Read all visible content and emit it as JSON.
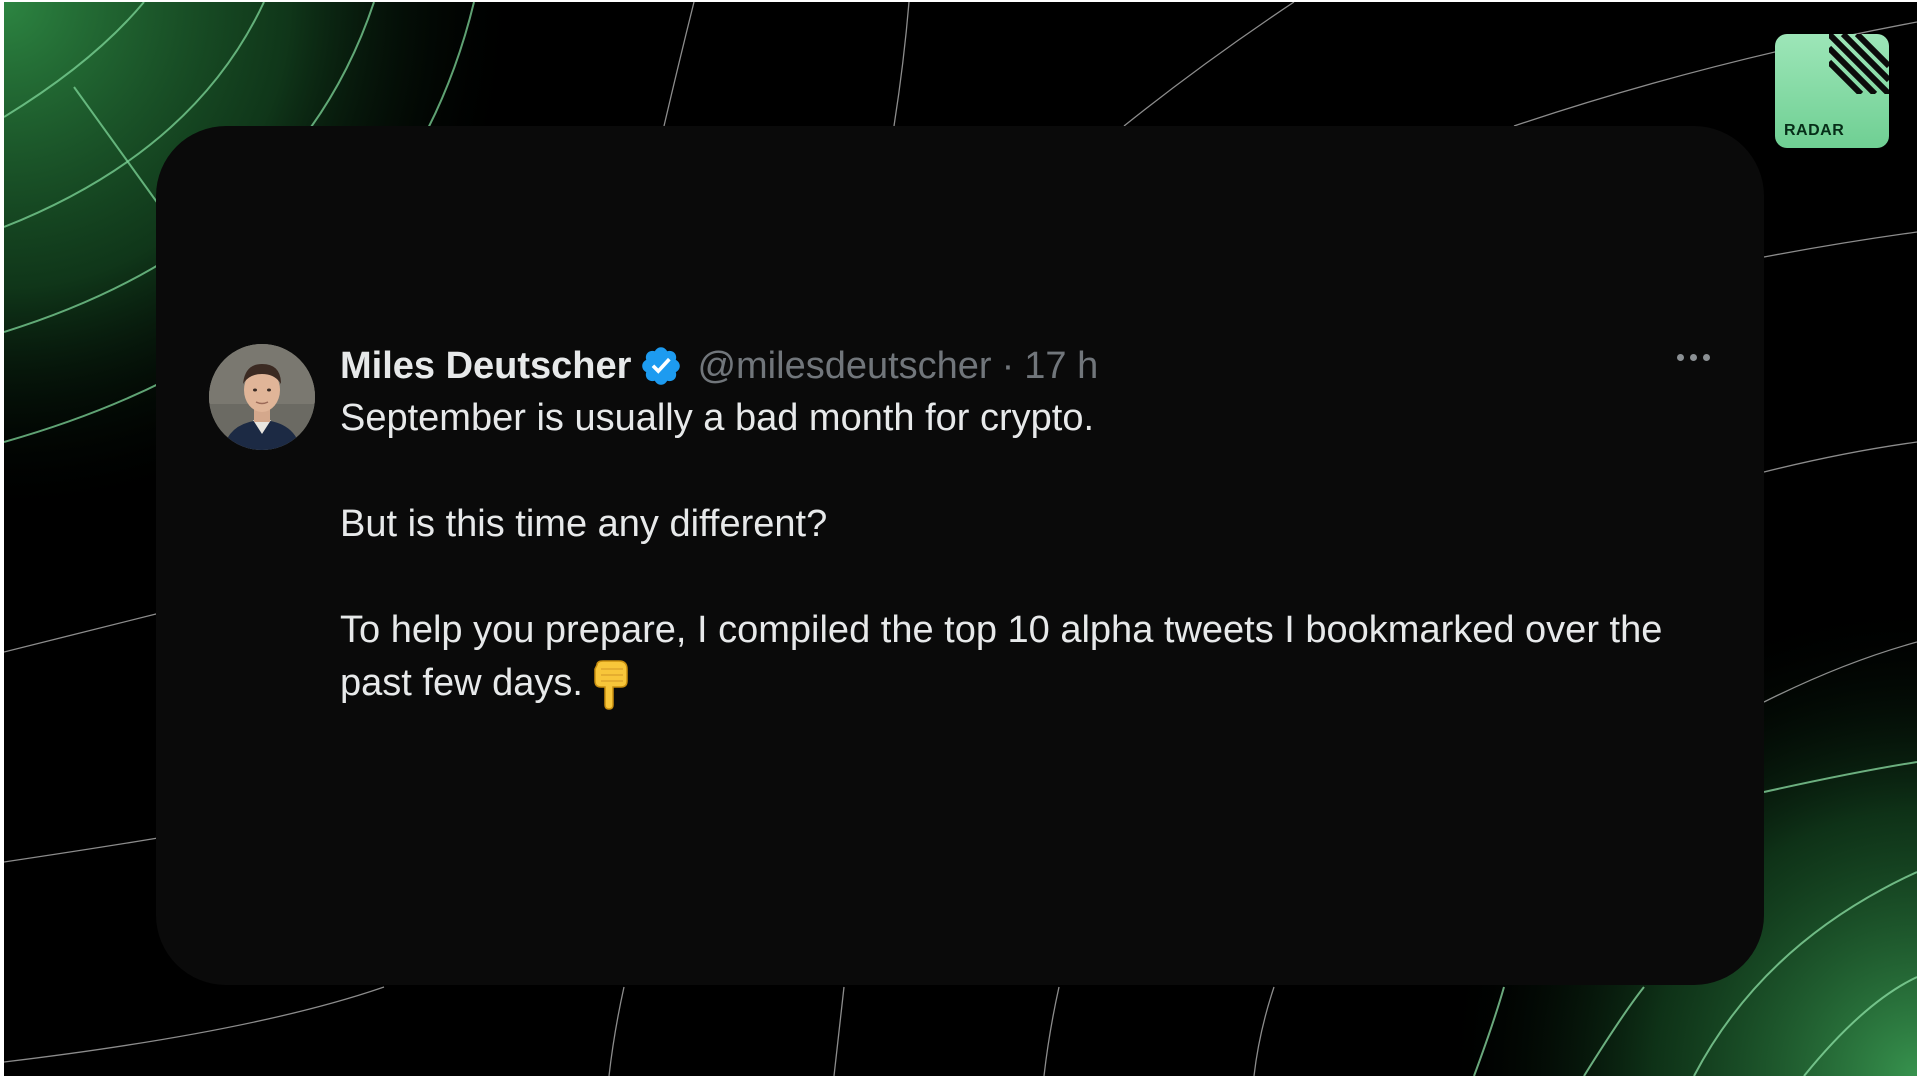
{
  "brand": {
    "logo_text": "RADAR",
    "accent_color": "#6fcf93"
  },
  "tweet": {
    "author_name": "Miles Deutscher",
    "verified": true,
    "verified_icon": "verified-badge-icon",
    "handle": "@milesdeutscher",
    "separator": "·",
    "time": "17 h",
    "more_icon": "more-options-icon",
    "paragraphs": [
      "September is usually a bad month for crypto.",
      "But is this time any different?",
      "To help you prepare, I compiled the top 10 alpha tweets I bookmarked over the past few days."
    ],
    "trailing_emoji": "backhand-index-pointing-down-icon"
  },
  "colors": {
    "background": "#000000",
    "card": "#0a0a0a",
    "text_primary": "#e7e9ea",
    "text_secondary": "#71767b",
    "verified_blue": "#1d9bf0"
  }
}
